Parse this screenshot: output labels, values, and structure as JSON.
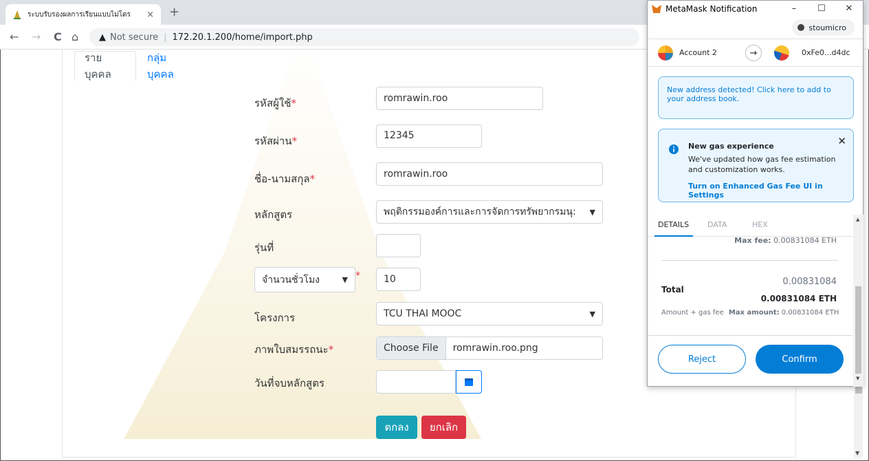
{
  "browser": {
    "tab_title": "ระบบรับรองผลการเรียนแบบไม่โดร",
    "tab_close": "×",
    "new_tab": "+",
    "back": "←",
    "forward": "→",
    "reload": "C",
    "home": "⌂",
    "warning_icon": "▲",
    "not_secure": "Not secure",
    "separator": "|",
    "url": "172.20.1.200/home/import.php"
  },
  "page": {
    "tabs": [
      "รายบุคคล",
      "กลุ่มบุคคล"
    ],
    "fields": {
      "username_label": "รหัสผู้ใช้",
      "username_value": "romrawin.roo",
      "password_label": "รหัสผ่าน",
      "password_value": "12345",
      "fullname_label": "ชื่อ-นามสกุล",
      "fullname_value": "romrawin.roo",
      "course_label": "หลักสูตร",
      "course_value": "พฤติกรรมองค์การและการจัดการทรัพยากรมนุ:",
      "batch_label": "รุ่นที่",
      "batch_value": "",
      "hours_select_value": "จำนวนชั่วโมง",
      "hours_value": "10",
      "project_label": "โครงการ",
      "project_value": "TCU THAI MOOC",
      "cert_label": "ภาพใบสมรรถนะ",
      "choose_file": "Choose File",
      "file_name": "romrawin.roo.png",
      "enddate_label": "วันที่จบหลักสูตร",
      "enddate_value": ""
    },
    "required_mark": "*",
    "ok_button": "ตกลง",
    "cancel_button": "ยกเลิก"
  },
  "metamask": {
    "window_title": "MetaMask Notification",
    "win_minimize": "–",
    "win_maximize": "☐",
    "win_close": "✕",
    "network": "stoumicro",
    "from_account": "Account 2",
    "to_address": "0xFe0...d4dc",
    "notice_address": "New address detected! Click here to add to your address book.",
    "gas_title": "New gas experience",
    "gas_body": "We've updated how gas fee estimation and customization works.",
    "gas_link": "Turn on Enhanced Gas Fee UI in Settings",
    "tabs": [
      "DETAILS",
      "DATA",
      "HEX"
    ],
    "max_fee_label": "Max fee:",
    "max_fee_value": "0.00831084 ETH",
    "total_label": "Total",
    "total_value_small": "0.00831084",
    "total_value_eth": "0.00831084 ETH",
    "amount_gas_label": "Amount + gas fee",
    "max_amount_label": "Max amount:",
    "max_amount_value": "0.00831084 ETH",
    "reject": "Reject",
    "confirm": "Confirm"
  },
  "colors": {
    "primary_link": "#007bff",
    "ok_button": "#17a2b8",
    "cancel_button": "#dc3545",
    "metamask_blue": "#037dd6",
    "required": "#dc3545"
  }
}
